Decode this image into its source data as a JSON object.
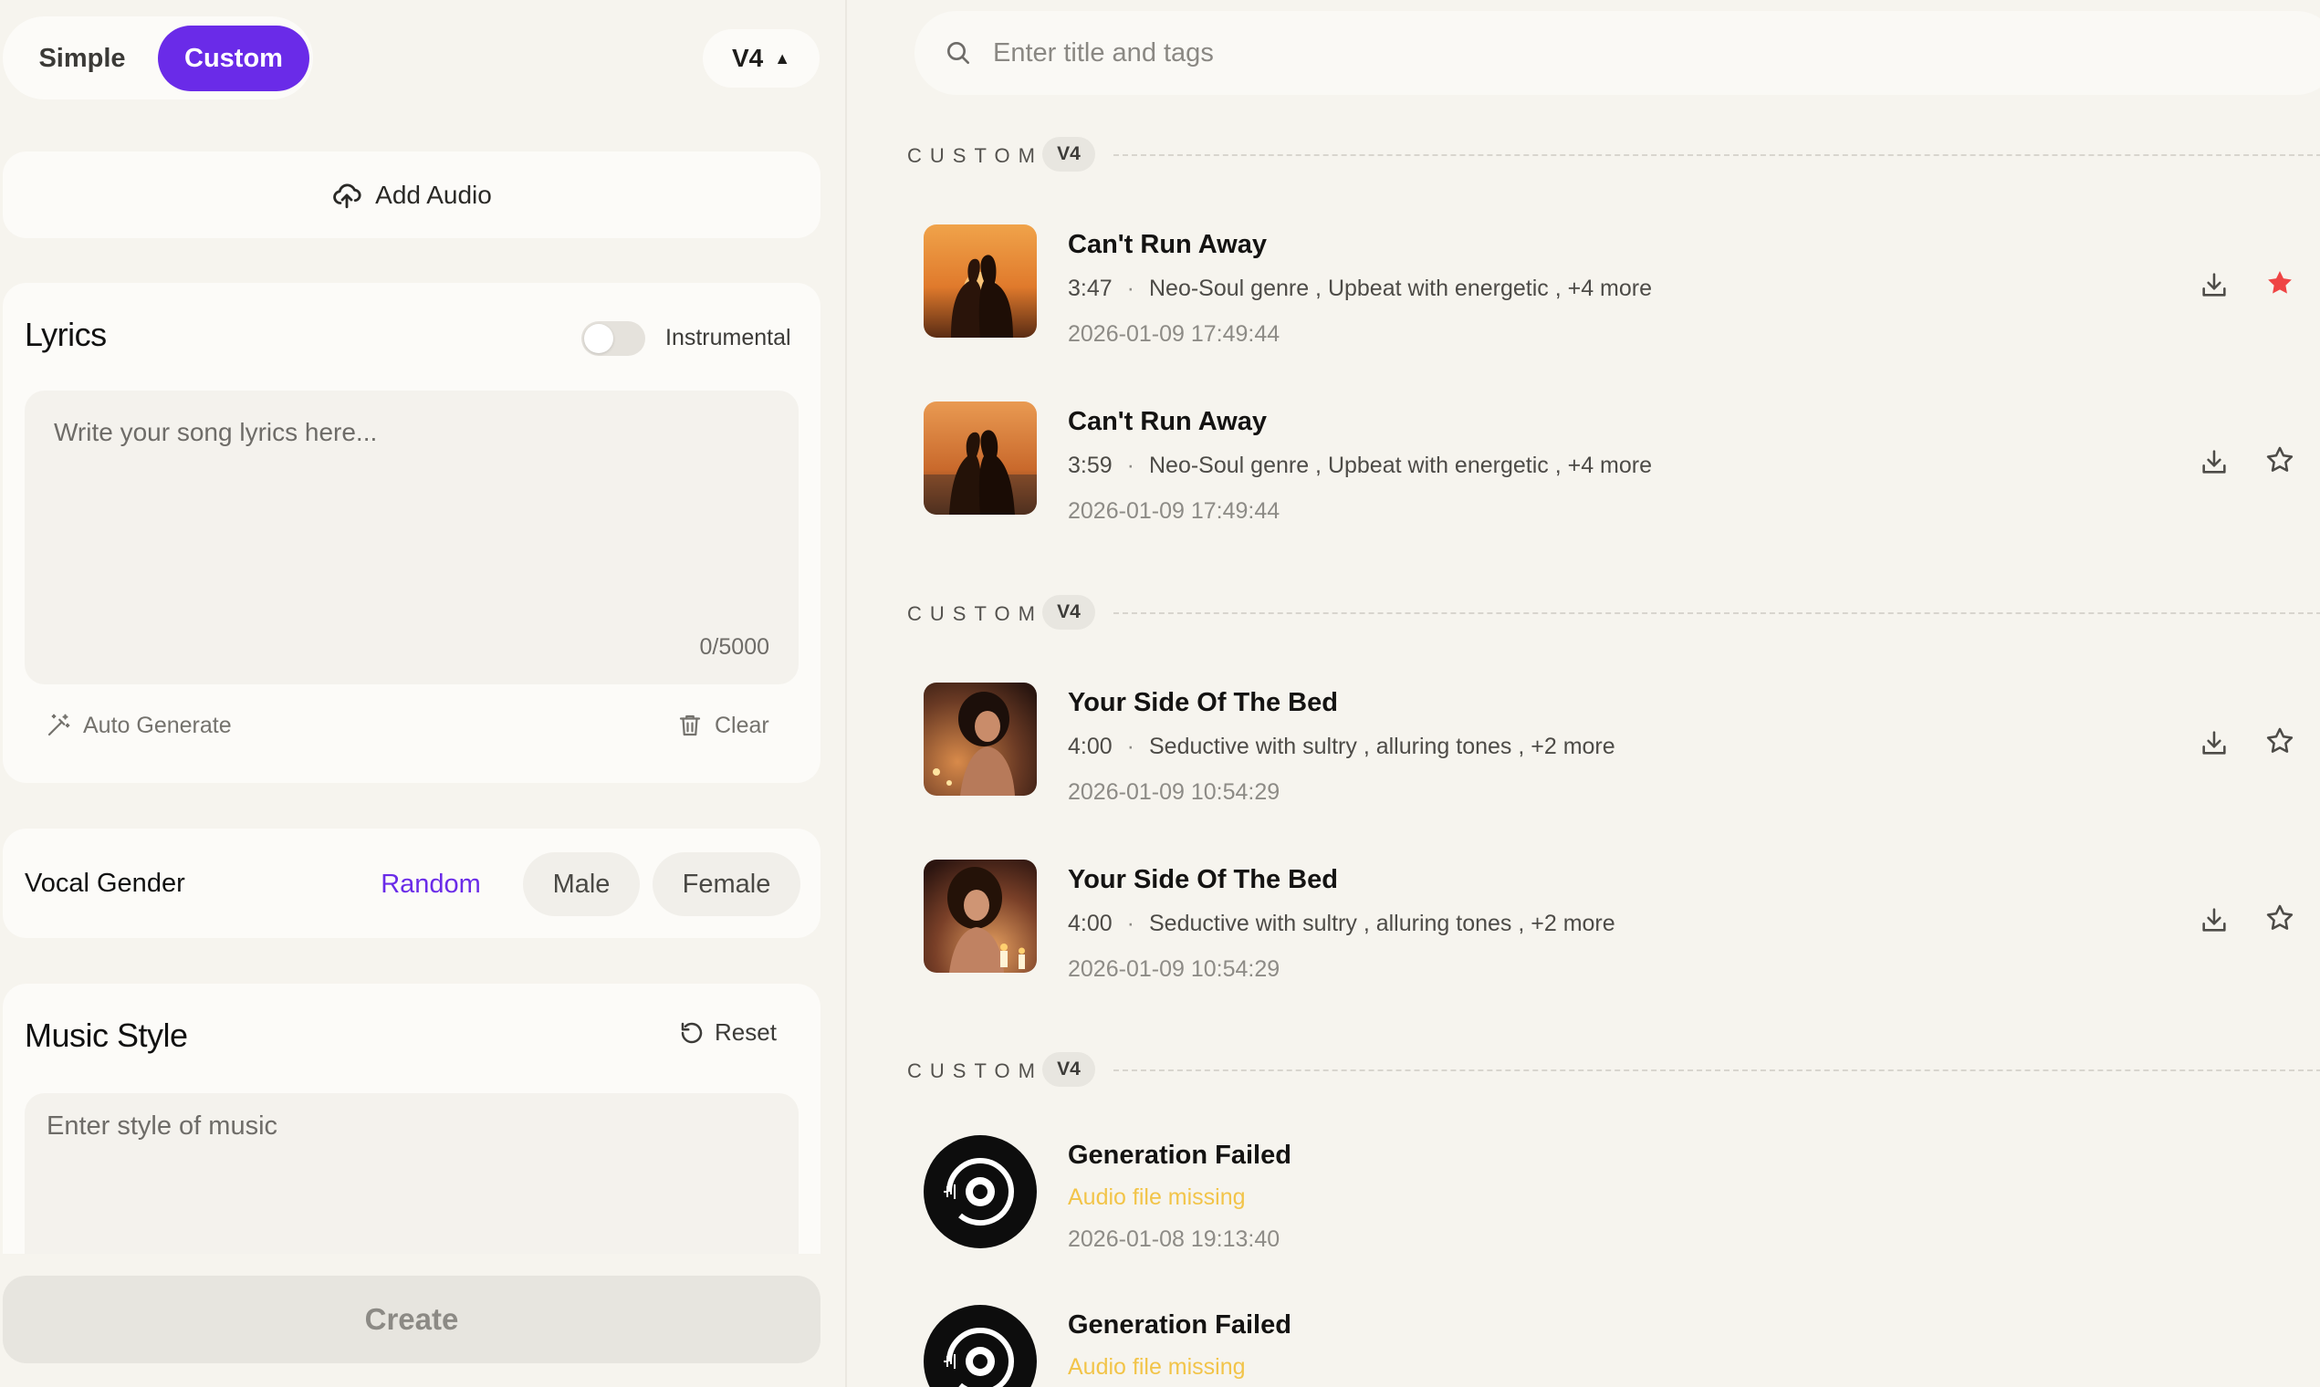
{
  "colors": {
    "accent": "#6a2be8",
    "favorite": "#ef4444",
    "warning": "#f2c449"
  },
  "left": {
    "mode_simple": "Simple",
    "mode_custom": "Custom",
    "version": "V4",
    "add_audio": "Add Audio",
    "lyrics": {
      "title": "Lyrics",
      "instrumental_label": "Instrumental",
      "instrumental_on": false,
      "placeholder": "Write your song lyrics here...",
      "char_count": "0/5000",
      "auto_generate": "Auto Generate",
      "clear": "Clear"
    },
    "vocal": {
      "label": "Vocal Gender",
      "options": [
        "Random",
        "Male",
        "Female"
      ],
      "selected": "Random"
    },
    "style": {
      "title": "Music Style",
      "reset": "Reset",
      "placeholder": "Enter style of music"
    },
    "create": "Create"
  },
  "right": {
    "search_placeholder": "Enter title and tags",
    "groups": [
      {
        "label": "CUSTOM",
        "badge": "V4",
        "songs": [
          {
            "title": "Can't Run Away",
            "duration": "3:47",
            "tags": "Neo-Soul genre , Upbeat with energetic , +4 more",
            "date": "2026-01-09 17:49:44",
            "favorited": true,
            "thumb_icon": "couple-sunset-image"
          },
          {
            "title": "Can't Run Away",
            "duration": "3:59",
            "tags": "Neo-Soul genre , Upbeat with energetic , +4 more",
            "date": "2026-01-09 17:49:44",
            "favorited": false,
            "thumb_icon": "couple-sunset-image"
          }
        ]
      },
      {
        "label": "CUSTOM",
        "badge": "V4",
        "songs": [
          {
            "title": "Your Side Of The Bed",
            "duration": "4:00",
            "tags": "Seductive with sultry , alluring tones , +2 more",
            "date": "2026-01-09 10:54:29",
            "favorited": false,
            "thumb_icon": "woman-candlelight-image"
          },
          {
            "title": "Your Side Of The Bed",
            "duration": "4:00",
            "tags": "Seductive with sultry , alluring tones , +2 more",
            "date": "2026-01-09 10:54:29",
            "favorited": false,
            "thumb_icon": "woman-candlelight-image"
          }
        ]
      },
      {
        "label": "CUSTOM",
        "badge": "V4",
        "songs": [
          {
            "title": "Generation Failed",
            "error": "Audio file missing",
            "date": "2026-01-08 19:13:40",
            "thumb_icon": "vinyl-disc-icon"
          },
          {
            "title": "Generation Failed",
            "error": "Audio file missing",
            "thumb_icon": "vinyl-disc-icon"
          }
        ]
      }
    ]
  }
}
